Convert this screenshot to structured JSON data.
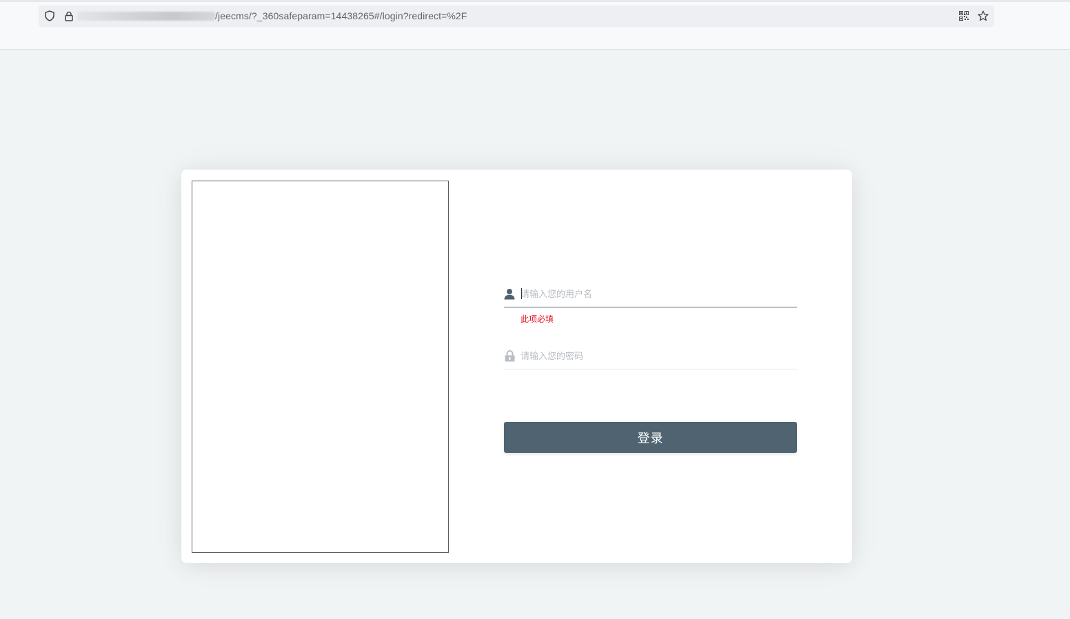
{
  "browser": {
    "url": "/jeecms/?_360safeparam=14438265#/login?redirect=%2F"
  },
  "login": {
    "username_placeholder": "请输入您的用户名",
    "username_value": "",
    "username_error": "此项必填",
    "password_placeholder": "请输入您的密码",
    "password_value": "",
    "submit_label": "登录"
  },
  "colors": {
    "page_background": "#f1f4f5",
    "button": "#4f6470",
    "error": "#e0101e",
    "icon_active": "#4f6270",
    "icon_inactive": "#b9bec3"
  },
  "icons": {
    "address_bar": [
      "shield-icon",
      "lock-icon",
      "qr-code-icon",
      "star-icon"
    ],
    "username": "user-icon",
    "password": "padlock-icon"
  }
}
